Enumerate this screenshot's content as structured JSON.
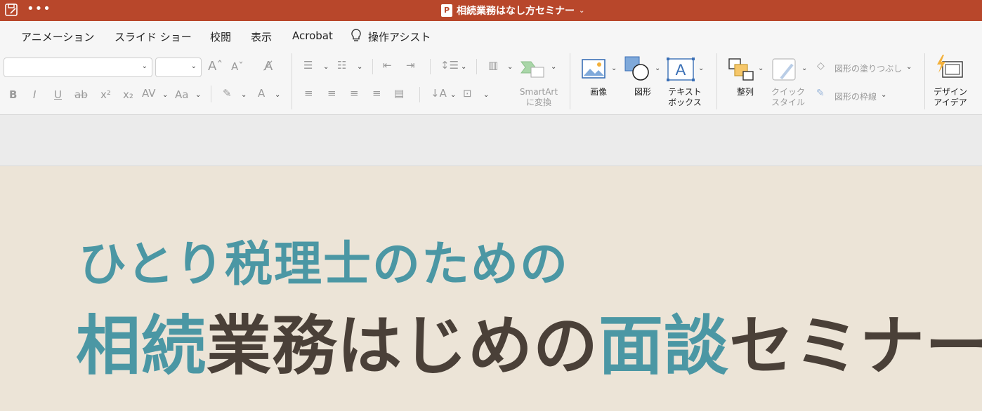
{
  "titlebar": {
    "title": "相続業務はなし方セミナー",
    "badge": "P"
  },
  "menu": [
    "アニメーション",
    "スライド ショー",
    "校閲",
    "表示",
    "Acrobat",
    "操作アシスト"
  ],
  "ribbon": {
    "smartart": [
      "SmartArt",
      "に変換"
    ],
    "image": "画像",
    "shape": "図形",
    "textbox": [
      "テキスト",
      "ボックス"
    ],
    "arrange": "整列",
    "quickstyle": [
      "クイック",
      "スタイル"
    ],
    "shape_fill": "図形の塗りつぶし",
    "shape_outline": "図形の枠線",
    "design": [
      "デザイン",
      "アイデア"
    ],
    "format": {
      "bold": "B",
      "italic": "I",
      "underline": "U",
      "strike": "ab",
      "sup": "x²",
      "sub": "x₂",
      "spacing": "AV",
      "case": "Aa",
      "fontcolor": "A"
    }
  },
  "slide": {
    "line1": "ひとり税理士のための",
    "line2_parts": [
      {
        "text": "相続",
        "accent": true
      },
      {
        "text": "業務はじめの",
        "accent": false
      },
      {
        "text": "面談",
        "accent": true
      },
      {
        "text": "セミナー",
        "accent": false
      }
    ]
  },
  "colors": {
    "titlebar": "#b8472b",
    "accent": "#4b97a4",
    "dark_text": "#4a4038",
    "slide_bg": "#ece4d7"
  }
}
